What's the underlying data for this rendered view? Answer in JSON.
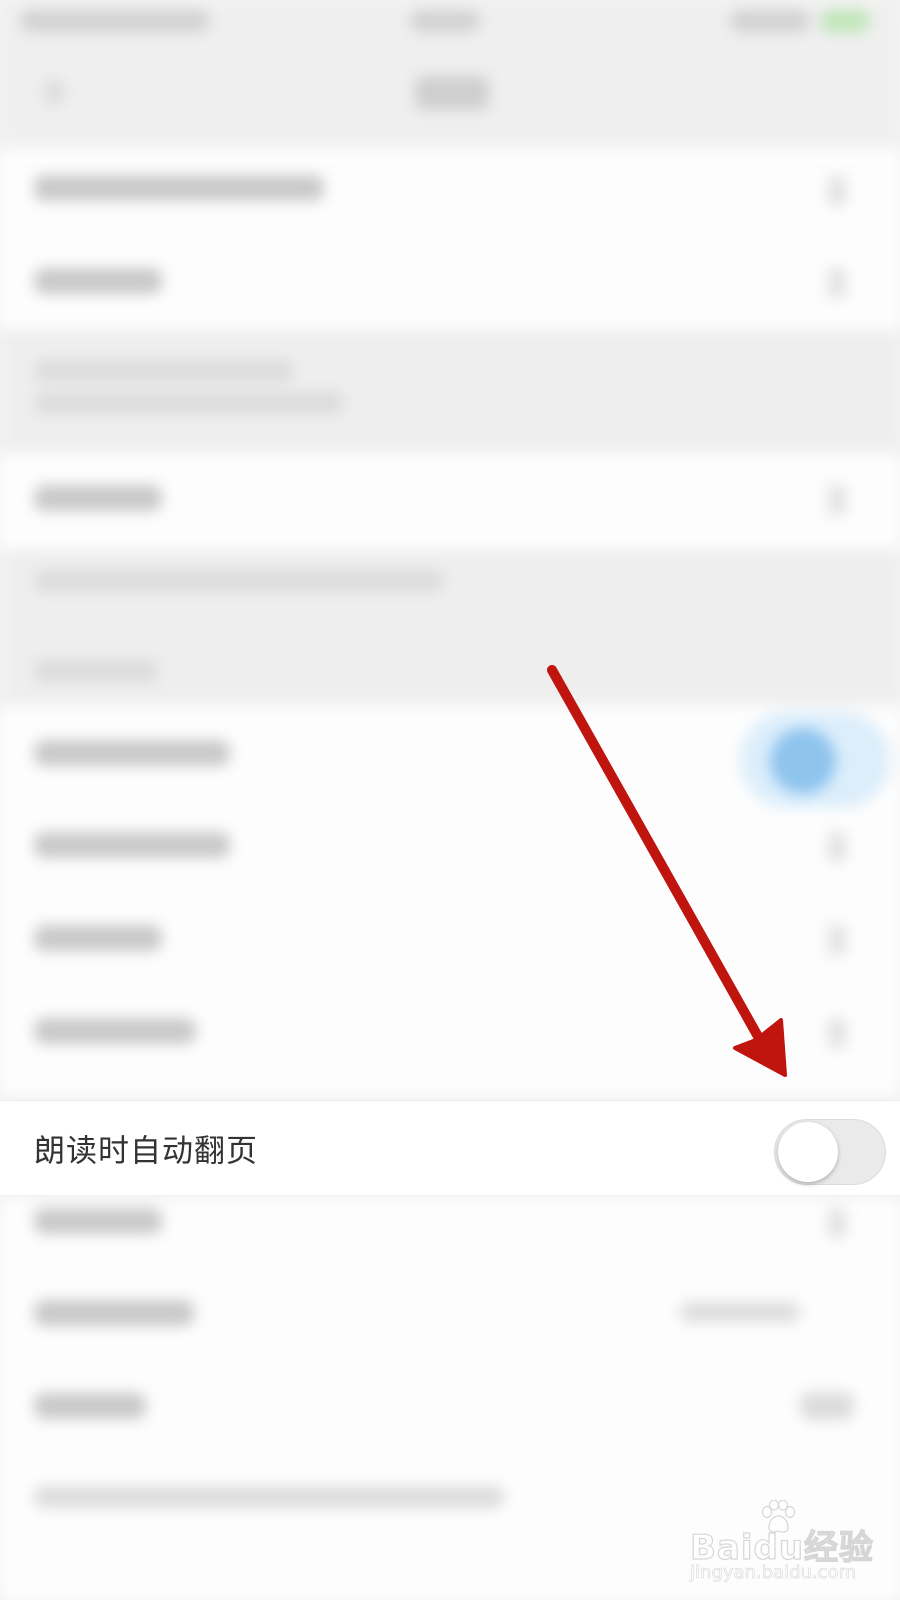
{
  "setting": {
    "label": "朗读时自动翻页",
    "toggle_state": "off"
  },
  "watermark": {
    "logo_text": "Baidu经验",
    "url": "jingyan.baidu.com"
  },
  "colors": {
    "arrow": "#c0140f",
    "toggle_track_off": "#eaeaea",
    "toggle_knob": "#ffffff",
    "label_text": "#333333"
  },
  "icons": {
    "annotation": "arrow-down-right-icon",
    "watermark_mark": "baidu-paw-icon"
  }
}
